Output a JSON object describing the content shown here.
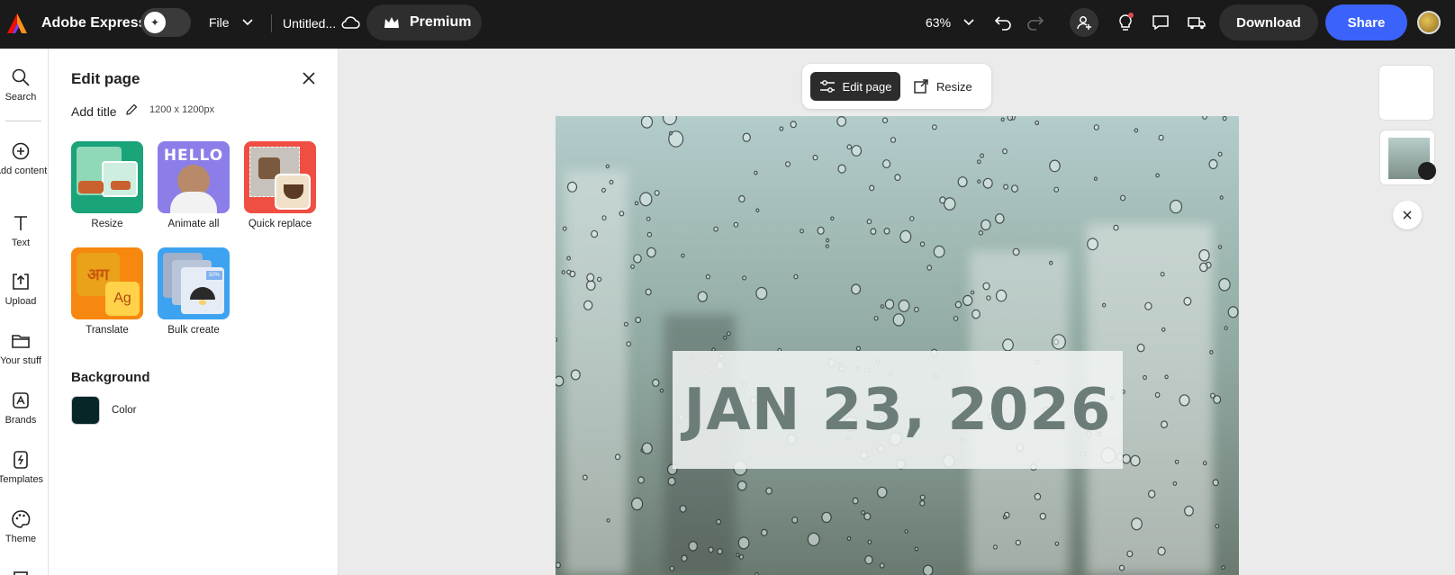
{
  "app": {
    "name": "Adobe Express",
    "brand_color": "#eb1000"
  },
  "header": {
    "file_menu": "File",
    "doc_title": "Untitled...",
    "premium_label": "Premium",
    "zoom_level": "63%",
    "download_label": "Download",
    "share_label": "Share",
    "share_color": "#3b63fb"
  },
  "rail": {
    "items": [
      {
        "label": "Search",
        "icon": "search-icon"
      },
      {
        "label": "Add content",
        "icon": "plus-circle-icon"
      },
      {
        "label": "Text",
        "icon": "text-icon"
      },
      {
        "label": "Upload",
        "icon": "upload-icon"
      },
      {
        "label": "Your stuff",
        "icon": "folder-icon"
      },
      {
        "label": "Brands",
        "icon": "brand-icon"
      },
      {
        "label": "Templates",
        "icon": "templates-icon"
      },
      {
        "label": "Theme",
        "icon": "palette-icon"
      }
    ]
  },
  "panel": {
    "title": "Edit page",
    "add_title": "Add title",
    "dimensions": "1200 x 1200px",
    "tiles": [
      {
        "label": "Resize"
      },
      {
        "label": "Animate all",
        "thumb_text": "HELLO"
      },
      {
        "label": "Quick replace"
      },
      {
        "label": "Translate",
        "thumb_text_a": "अग",
        "thumb_text_b": "Ag"
      },
      {
        "label": "Bulk create",
        "thumb_text": "50%"
      }
    ],
    "background_section": "Background",
    "background_color_label": "Color",
    "background_color": "#062628"
  },
  "canvas": {
    "edit_page_label": "Edit page",
    "resize_label": "Resize",
    "date_text": "JAN 23, 2026"
  }
}
